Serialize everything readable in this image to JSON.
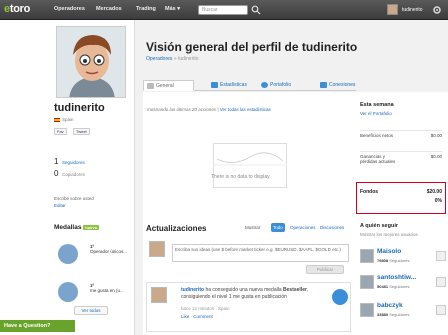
{
  "topbar": {
    "logo_prefix": "e",
    "logo_suffix": "toro",
    "nav": [
      "Operadores",
      "Mercados",
      "Trading",
      "Más"
    ],
    "more_caret": "▾",
    "search_placeholder": "Buscar",
    "username": "tudinerito"
  },
  "profile": {
    "username": "tudinerito",
    "country": "Spain",
    "social_buttons": [
      "Fav",
      "Tweet"
    ],
    "followers_count": "1",
    "followers_label": "Seguidores",
    "copiers_count": "0",
    "copiers_label": "Copiadores",
    "about_prompt": "Escribe sobre usted",
    "edit_link": "Editar",
    "medals_title": "Medallas",
    "medals_badge": "nuevo",
    "medals": [
      {
        "rank": "1º",
        "text": "Operador únicos..."
      },
      {
        "rank": "1º",
        "text": "me gusta en (u..."
      }
    ],
    "see_all": "Ver todos",
    "have_question": "Have a Question?"
  },
  "page": {
    "title": "Visión general del perfil de tudinerito",
    "breadcrumb_parent": "Operadores",
    "breadcrumb_sep": "»",
    "breadcrumb_current": "tudinerito",
    "tabs": [
      "General",
      "Estadísticas",
      "Portafolio",
      "Conexiones"
    ]
  },
  "performance": {
    "showing_text": "mostrando las últimas 20 acciones",
    "separator": "|",
    "all_stats_link": "Ver todas las estadísticas",
    "no_data": "There is no data to display."
  },
  "updates": {
    "title": "Actualizaciones",
    "show_label": "Mostrar:",
    "filters": [
      "Todo",
      "Operaciones",
      "Discusiones"
    ],
    "composer_placeholder": "Escriba sus ideas (use $ before market ticker e.g. $EURUSD, $AAPL, $GOLD etc.)",
    "publish_button": "Publicar",
    "feed": [
      {
        "user": "tudinerito",
        "text_before": " ha conseguido una nueva medalla ",
        "medal_name": "Bestseller",
        "text_after": ", consiguiendo el nivel 1 me gusta en publicación",
        "meta": "hace 12 minutos · Spain",
        "actions": [
          "Like",
          "Comment"
        ],
        "action_sep": "·"
      }
    ]
  },
  "sidebar": {
    "week_title": "Esta semana",
    "portfolio_link": "Ver el Portafolio",
    "rows": [
      {
        "label": "Beneficios netos",
        "value": "$0.00"
      },
      {
        "label": "Ganancias y pérdidas actuales",
        "value": "$0.00"
      }
    ],
    "funds_label": "Fondos",
    "funds_value": "$20.00",
    "funds_percent": "0%",
    "follow_title": "A quién seguir",
    "follow_subtitle": "Mostrar los mejores usuarios",
    "suggestions": [
      {
        "name": "Maisolo",
        "followers": "79808",
        "followers_label": "Seguidores"
      },
      {
        "name": "santoshtiw...",
        "followers": "50481",
        "followers_label": "Seguidores"
      },
      {
        "name": "babczyk",
        "followers": "33880",
        "followers_label": "Seguidores"
      }
    ]
  },
  "colors": {
    "brand_green": "#8bc43f",
    "link_blue": "#1a6bb8",
    "highlight_red": "#d0021b",
    "topbar": "#4a4a4a"
  }
}
